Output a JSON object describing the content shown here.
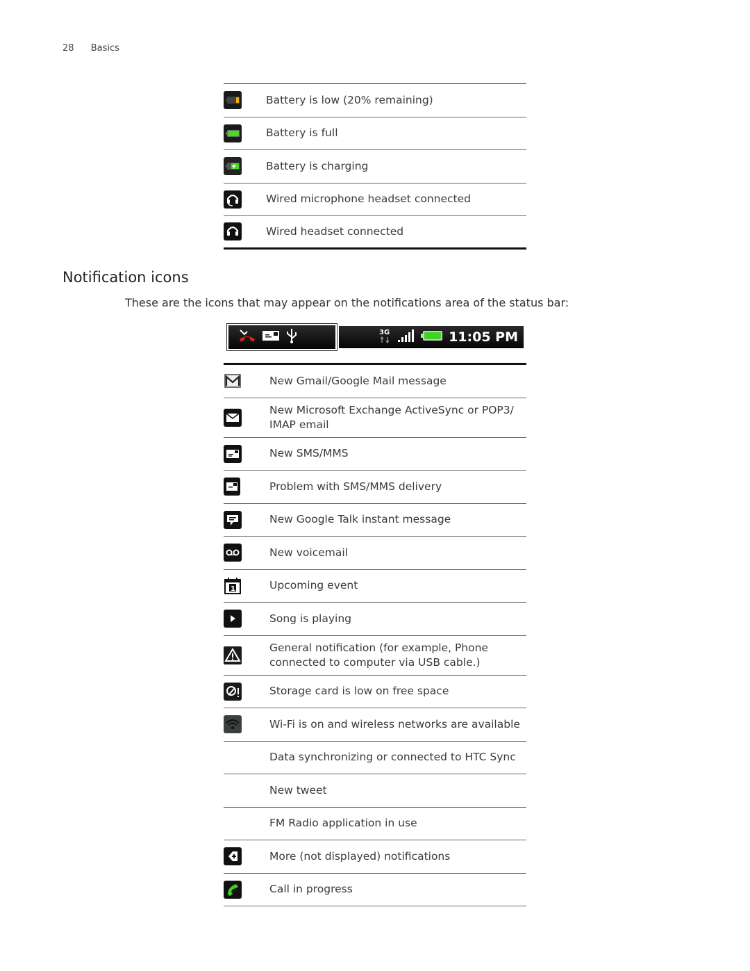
{
  "header": {
    "page_number": "28",
    "section": "Basics"
  },
  "battery_table": [
    {
      "icon": "battery-low-icon",
      "label": "Battery is low (20% remaining)"
    },
    {
      "icon": "battery-full-icon",
      "label": "Battery is full"
    },
    {
      "icon": "battery-charging-icon",
      "label": "Battery is charging"
    },
    {
      "icon": "headset-mic-icon",
      "label": "Wired microphone headset connected"
    },
    {
      "icon": "headset-icon",
      "label": "Wired headset connected"
    }
  ],
  "notification_section": {
    "title": "Notification icons",
    "intro": "These are the icons that may appear on the notifications area of the status bar:",
    "status_bar": {
      "left_icons": [
        "missed-call-icon",
        "sms-icon",
        "usb-icon"
      ],
      "right_icons": [
        "3g-icon",
        "signal-icon",
        "battery-icon"
      ],
      "time": "11:05 PM"
    }
  },
  "notification_table": [
    {
      "icon": "gmail-icon",
      "label": "New Gmail/Google Mail message"
    },
    {
      "icon": "email-icon",
      "label": "New Microsoft Exchange ActiveSync or POP3/ IMAP email",
      "tall": true
    },
    {
      "icon": "sms-icon",
      "label": "New SMS/MMS"
    },
    {
      "icon": "sms-problem-icon",
      "label": "Problem with SMS/MMS delivery"
    },
    {
      "icon": "google-talk-icon",
      "label": "New Google Talk instant message"
    },
    {
      "icon": "voicemail-icon",
      "label": "New voicemail"
    },
    {
      "icon": "calendar-icon",
      "label": "Upcoming event"
    },
    {
      "icon": "play-icon",
      "label": "Song is playing"
    },
    {
      "icon": "warning-icon",
      "label": "General notification (for example, Phone connected to computer via USB cable.)",
      "tall": true
    },
    {
      "icon": "storage-low-icon",
      "label": "Storage card is low on free space"
    },
    {
      "icon": "wifi-icon",
      "label": "Wi-Fi is on and wireless networks are available"
    },
    {
      "icon": "",
      "label": "Data synchronizing or connected to HTC Sync"
    },
    {
      "icon": "",
      "label": "New tweet"
    },
    {
      "icon": "",
      "label": "FM Radio application in use"
    },
    {
      "icon": "more-notifications-icon",
      "label": "More (not displayed) notifications"
    },
    {
      "icon": "call-in-progress-icon",
      "label": "Call in progress"
    }
  ]
}
